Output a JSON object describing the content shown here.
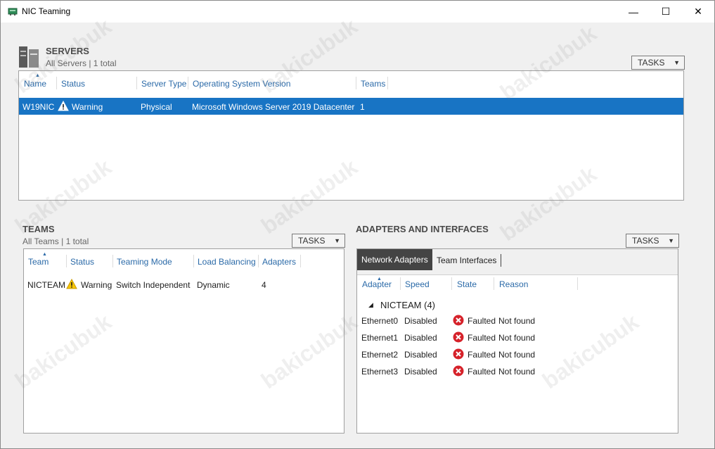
{
  "window": {
    "title": "NIC Teaming",
    "minimize_glyph": "—",
    "maximize_glyph": "☐",
    "close_glyph": "✕"
  },
  "servers": {
    "title": "SERVERS",
    "subtitle": "All Servers | 1 total",
    "tasks_label": "TASKS",
    "columns": [
      "Name",
      "Status",
      "Server Type",
      "Operating System Version",
      "Teams"
    ],
    "rows": [
      {
        "name": "W19NIC",
        "status": "Warning",
        "server_type": "Physical",
        "os_version": "Microsoft Windows Server 2019 Datacenter",
        "teams": "1"
      }
    ]
  },
  "teams": {
    "title": "TEAMS",
    "subtitle": "All Teams | 1 total",
    "tasks_label": "TASKS",
    "columns": [
      "Team",
      "Status",
      "Teaming Mode",
      "Load Balancing",
      "Adapters"
    ],
    "rows": [
      {
        "team": "NICTEAM",
        "status": "Warning",
        "teaming_mode": "Switch Independent",
        "load_balancing": "Dynamic",
        "adapters": "4"
      }
    ]
  },
  "adapters": {
    "title": "ADAPTERS AND INTERFACES",
    "tasks_label": "TASKS",
    "tabs": [
      "Network Adapters",
      "Team Interfaces"
    ],
    "columns": [
      "Adapter",
      "Speed",
      "State",
      "Reason"
    ],
    "group_label": "NICTEAM (4)",
    "rows": [
      {
        "adapter": "Ethernet0",
        "speed": "Disabled",
        "state": "Faulted",
        "reason": "Not found"
      },
      {
        "adapter": "Ethernet1",
        "speed": "Disabled",
        "state": "Faulted",
        "reason": "Not found"
      },
      {
        "adapter": "Ethernet2",
        "speed": "Disabled",
        "state": "Faulted",
        "reason": "Not found"
      },
      {
        "adapter": "Ethernet3",
        "speed": "Disabled",
        "state": "Faulted",
        "reason": "Not found"
      }
    ]
  },
  "watermark_text": "bakicubuk",
  "colors": {
    "selection": "#1874c4",
    "header_link": "#2b6aa8",
    "warning": "#f7c600",
    "error": "#d6222a"
  }
}
